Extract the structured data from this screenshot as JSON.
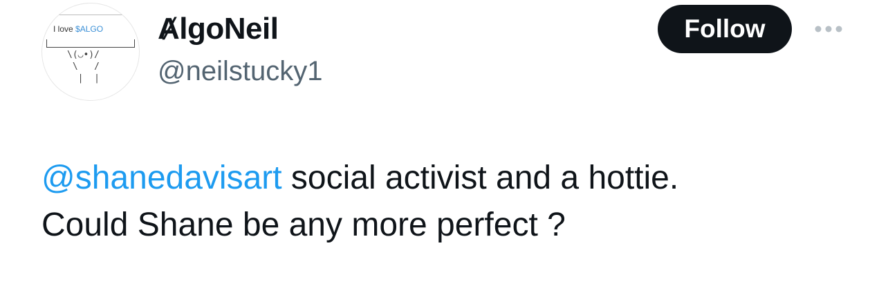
{
  "avatar": {
    "sign_text": "I love ",
    "sign_ticker": "$ALGO",
    "figure": "\\(◡•)/\n \\   /\n  |  |"
  },
  "author": {
    "display_name": "ȺlgoNeil",
    "handle": "@neilstucky1"
  },
  "actions": {
    "follow_label": "Follow",
    "more_icon": "more-horizontal-icon"
  },
  "tweet": {
    "mention": "@shanedavisart",
    "line1_rest": " social activist and a hottie.",
    "line2": "Could Shane be any more perfect ?"
  },
  "colors": {
    "mention": "#1d9bf0",
    "text": "#0f1419",
    "secondary": "#536471",
    "follow_bg": "#0f1419"
  }
}
